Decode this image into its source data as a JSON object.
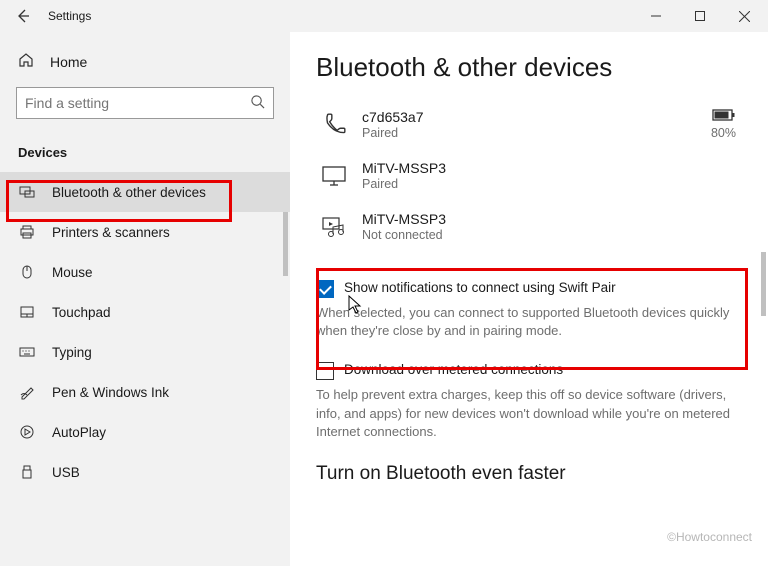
{
  "window": {
    "app_title": "Settings"
  },
  "sidebar": {
    "home_label": "Home",
    "search_placeholder": "Find a setting",
    "section_label": "Devices",
    "items": [
      {
        "label": "Bluetooth & other devices",
        "selected": true
      },
      {
        "label": "Printers & scanners"
      },
      {
        "label": "Mouse"
      },
      {
        "label": "Touchpad"
      },
      {
        "label": "Typing"
      },
      {
        "label": "Pen & Windows Ink"
      },
      {
        "label": "AutoPlay"
      },
      {
        "label": "USB"
      }
    ]
  },
  "main": {
    "title": "Bluetooth & other devices",
    "devices": [
      {
        "name": "c7d653a7",
        "status": "Paired",
        "battery": "80%"
      },
      {
        "name": "MiTV-MSSP3",
        "status": "Paired"
      },
      {
        "name": "MiTV-MSSP3",
        "status": "Not connected"
      }
    ],
    "swift_pair": {
      "label": "Show notifications to connect using Swift Pair",
      "helper": "When selected, you can connect to supported Bluetooth devices quickly when they're close by and in pairing mode.",
      "checked": true
    },
    "metered": {
      "label": "Download over metered connections",
      "helper": "To help prevent extra charges, keep this off so device software (drivers, info, and apps) for new devices won't download while you're on metered Internet connections.",
      "checked": false
    },
    "sub_heading": "Turn on Bluetooth even faster",
    "watermark": "©Howtoconnect"
  }
}
